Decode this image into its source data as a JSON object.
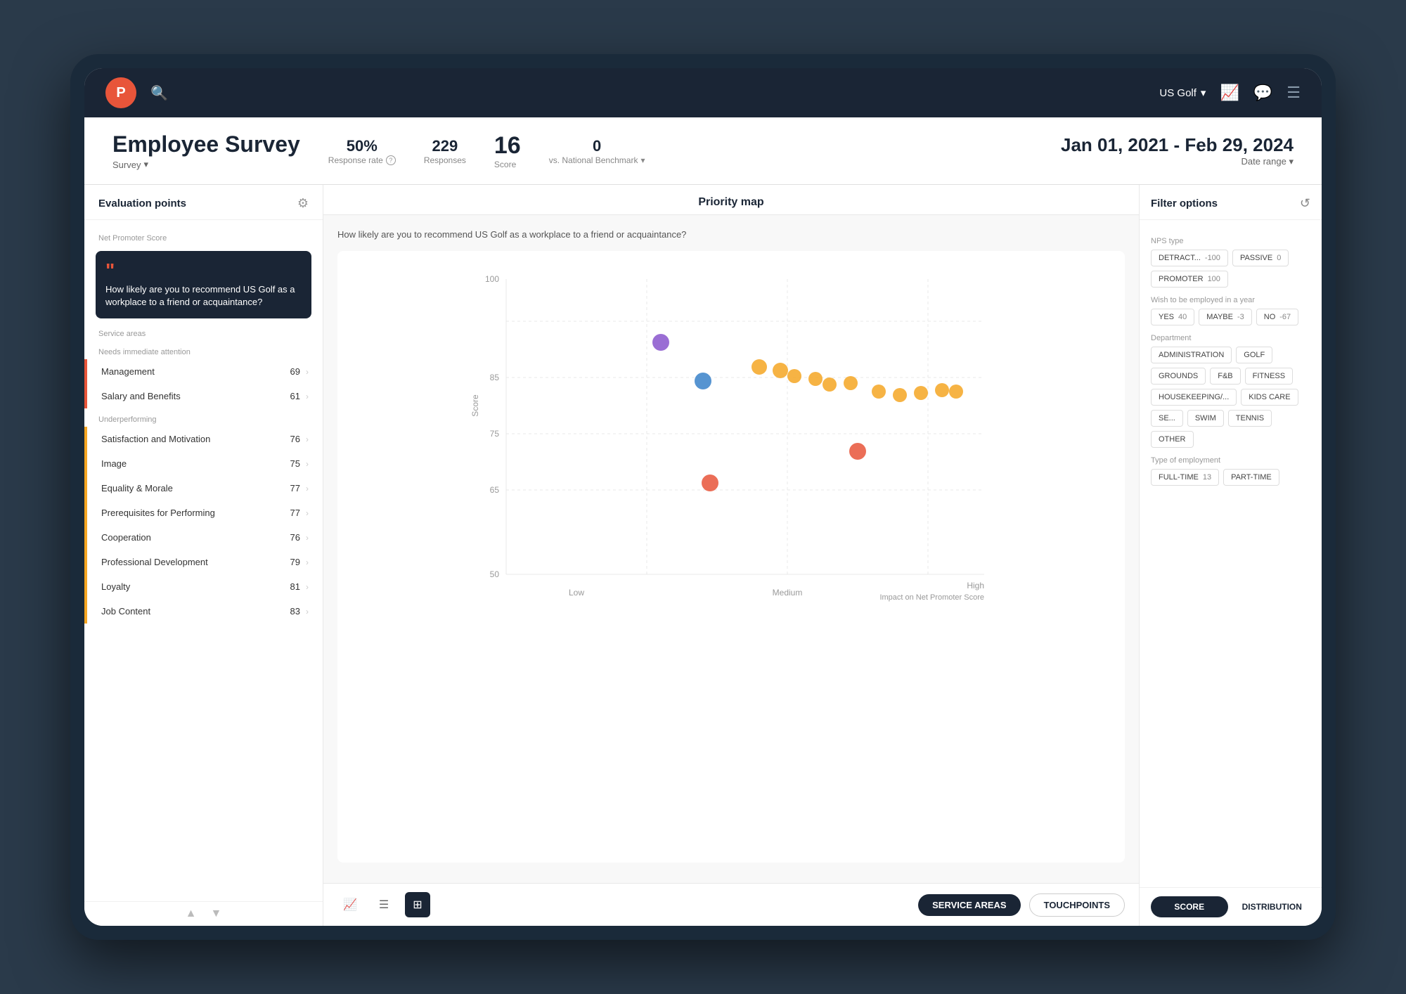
{
  "app": {
    "logo_letter": "P"
  },
  "nav": {
    "org_name": "US Golf",
    "search_placeholder": "Search..."
  },
  "header": {
    "title": "Employee Survey",
    "breadcrumb": "Survey",
    "response_rate": "50%",
    "response_rate_label": "Response rate",
    "responses": "229",
    "responses_label": "Responses",
    "score": "16",
    "score_label": "Score",
    "benchmark": "0",
    "benchmark_label": "vs. National Benchmark",
    "date_range": "Jan 01, 2021 - Feb 29, 2024",
    "date_label": "Date range"
  },
  "evaluation": {
    "panel_title": "Evaluation points",
    "nps_label": "Net Promoter Score",
    "featured_question": "How likely are you to recommend US Golf as a workplace to a friend or acquaintance?",
    "service_areas_label": "Service areas",
    "needs_attention_label": "Needs immediate attention",
    "underperforming_label": "Underperforming",
    "items": [
      {
        "label": "Management",
        "value": "69",
        "category": "red"
      },
      {
        "label": "Salary and Benefits",
        "value": "61",
        "category": "red"
      },
      {
        "label": "Satisfaction and Motivation",
        "value": "76",
        "category": "orange"
      },
      {
        "label": "Image",
        "value": "75",
        "category": "orange"
      },
      {
        "label": "Equality & Morale",
        "value": "77",
        "category": "orange"
      },
      {
        "label": "Prerequisites for Performing",
        "value": "77",
        "category": "orange"
      },
      {
        "label": "Cooperation",
        "value": "76",
        "category": "orange"
      },
      {
        "label": "Professional Development",
        "value": "79",
        "category": "orange"
      },
      {
        "label": "Loyalty",
        "value": "81",
        "category": "orange"
      },
      {
        "label": "Job Content",
        "value": "83",
        "category": "orange"
      }
    ]
  },
  "priority_map": {
    "title": "Priority map",
    "question": "How likely are you to recommend US Golf as a workplace to a friend or acquaintance?",
    "y_axis_label": "Score",
    "x_axis_low": "Low",
    "x_axis_medium": "Medium",
    "x_axis_high": "High",
    "x_axis_subtitle": "Impact on Net Promoter Score",
    "y_values": [
      "100",
      "85",
      "75",
      "65",
      "50"
    ],
    "btn_service": "SERVICE AREAS",
    "btn_touchpoints": "TOUCHPOINTS"
  },
  "filter_options": {
    "title": "Filter options",
    "nps_type_label": "NPS type",
    "nps_tags": [
      {
        "label": "DETRACT...",
        "value": "-100"
      },
      {
        "label": "PASSIVE",
        "value": "0"
      },
      {
        "label": "PROMOTER",
        "value": "100"
      }
    ],
    "wish_label": "Wish to be employed in a year",
    "wish_tags": [
      {
        "label": "YES",
        "value": "40"
      },
      {
        "label": "MAYBE",
        "value": "-3"
      },
      {
        "label": "NO",
        "value": "-67"
      }
    ],
    "department_label": "Department",
    "dept_tags": [
      {
        "label": "ADMINISTRATION",
        "value": ""
      },
      {
        "label": "GOLF",
        "value": ""
      },
      {
        "label": "GROUNDS",
        "value": ""
      },
      {
        "label": "F&B",
        "value": ""
      },
      {
        "label": "FITNESS",
        "value": ""
      },
      {
        "label": "HOUSEKEEPING/...",
        "value": ""
      },
      {
        "label": "KIDS CARE",
        "value": ""
      },
      {
        "label": "SE...",
        "value": ""
      },
      {
        "label": "SWIM",
        "value": ""
      },
      {
        "label": "TENNIS",
        "value": ""
      },
      {
        "label": "OTHER",
        "value": ""
      }
    ],
    "employment_label": "Type of employment",
    "employment_tags": [
      {
        "label": "FULL-TIME",
        "value": "13"
      },
      {
        "label": "PART-TIME",
        "value": ""
      }
    ],
    "btn_score": "SCORE",
    "btn_distribution": "DISTRIBUTION"
  }
}
